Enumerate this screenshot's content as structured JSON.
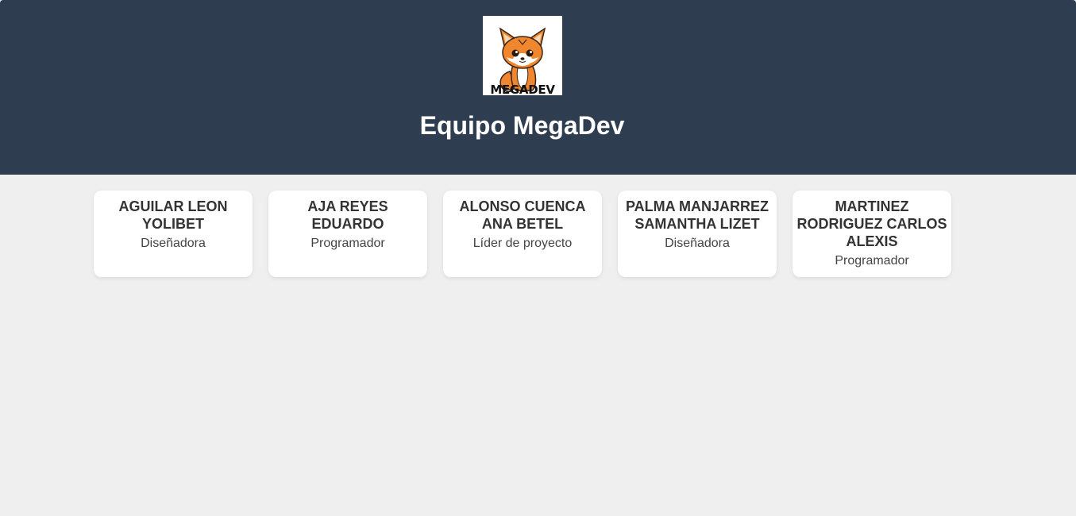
{
  "header": {
    "logo_text": "MEGADEV",
    "title": "Equipo MegaDev"
  },
  "team": [
    {
      "name": "AGUILAR LEON YOLIBET",
      "role": "Diseñadora"
    },
    {
      "name": "AJA REYES EDUARDO",
      "role": "Programador"
    },
    {
      "name": "ALONSO CUENCA ANA BETEL",
      "role": "Líder de proyecto"
    },
    {
      "name": "PALMA MANJARREZ SAMANTHA LIZET",
      "role": "Diseñadora"
    },
    {
      "name": "MARTINEZ RODRIGUEZ CARLOS ALEXIS",
      "role": "Programador"
    }
  ],
  "colors": {
    "header_bg": "#2e3d50",
    "page_bg": "#efefef",
    "card_bg": "#ffffff",
    "fox_orange": "#f0872f"
  },
  "icons": {
    "logo": "fox-mascot-logo"
  }
}
